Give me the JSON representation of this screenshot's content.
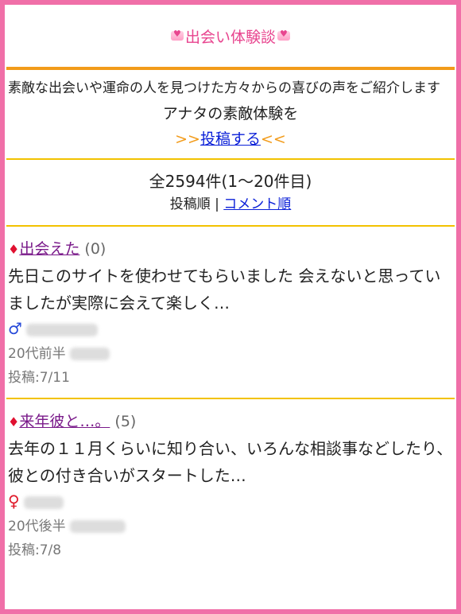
{
  "header": {
    "title": "出会い体験談"
  },
  "intro": {
    "text": "素敵な出会いや運命の人を見つけた方々からの喜びの声をご紹介します"
  },
  "cta": {
    "line1": "アナタの素敵体験を",
    "arrows_left": ">>",
    "link": "投稿する",
    "arrows_right": "<<"
  },
  "listing": {
    "count": "全2594件(1～20件目)",
    "sort_active": "投稿順",
    "separator": "|",
    "sort_link": "コメント順"
  },
  "stories": [
    {
      "title": "出会えた",
      "comments": "(0)",
      "body": "先日このサイトを使わせてもらいました 会えないと思っていましたが実際に会えて楽しく…",
      "gender_icon": "male-icon",
      "age": "20代前半",
      "posted": "投稿:7/11"
    },
    {
      "title": "来年彼と…。",
      "comments": "(5)",
      "body": "去年の１１月くらいに知り合い、いろんな相談事などしたり、彼との付き合いがスタートした…",
      "gender_icon": "female-icon",
      "age": "20代後半",
      "posted": "投稿:7/8"
    }
  ],
  "colors": {
    "frame": "#f06fa8",
    "header_text": "#e8458f",
    "orange_rule": "#f29b1a",
    "yellow_rule": "#f2c200",
    "link": "#0a1fd8",
    "story_link": "#7a1a8a"
  }
}
